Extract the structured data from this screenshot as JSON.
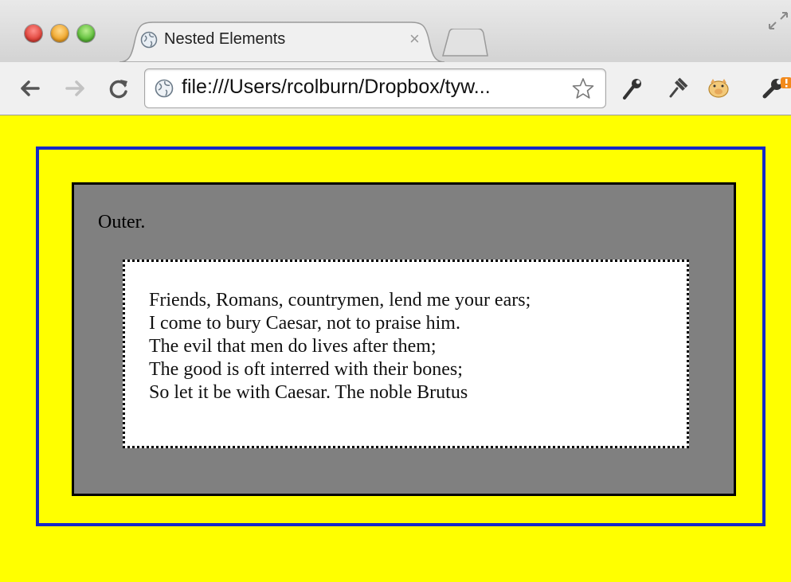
{
  "browser": {
    "tab": {
      "title": "Nested Elements",
      "close_glyph": "×",
      "favicon": "globe-icon"
    },
    "address_bar": {
      "url": "file:///Users/rcolburn/Dropbox/tyw...",
      "site_icon": "globe-icon",
      "bookmark_icon": "star-icon"
    },
    "nav": {
      "back_icon": "back-arrow-icon",
      "forward_icon": "forward-arrow-icon",
      "reload_icon": "reload-icon"
    },
    "extensions": [
      "wrench-icon",
      "pin-icon",
      "pig-icon",
      "settings-wrench-icon"
    ],
    "colors": {
      "traffic_close": "#e0453c",
      "traffic_minimize": "#f0a62c",
      "traffic_maximize": "#5fbe3b"
    }
  },
  "page": {
    "background_color": "#ffff00",
    "blue_border_color": "#1528c8",
    "gray_box_color": "#808080",
    "outer_text": "Outer.",
    "poem_lines": [
      "Friends, Romans, countrymen, lend me your ears;",
      "I come to bury Caesar, not to praise him.",
      "The evil that men do lives after them;",
      "The good is oft interred with their bones;",
      "So let it be with Caesar. The noble Brutus"
    ]
  }
}
